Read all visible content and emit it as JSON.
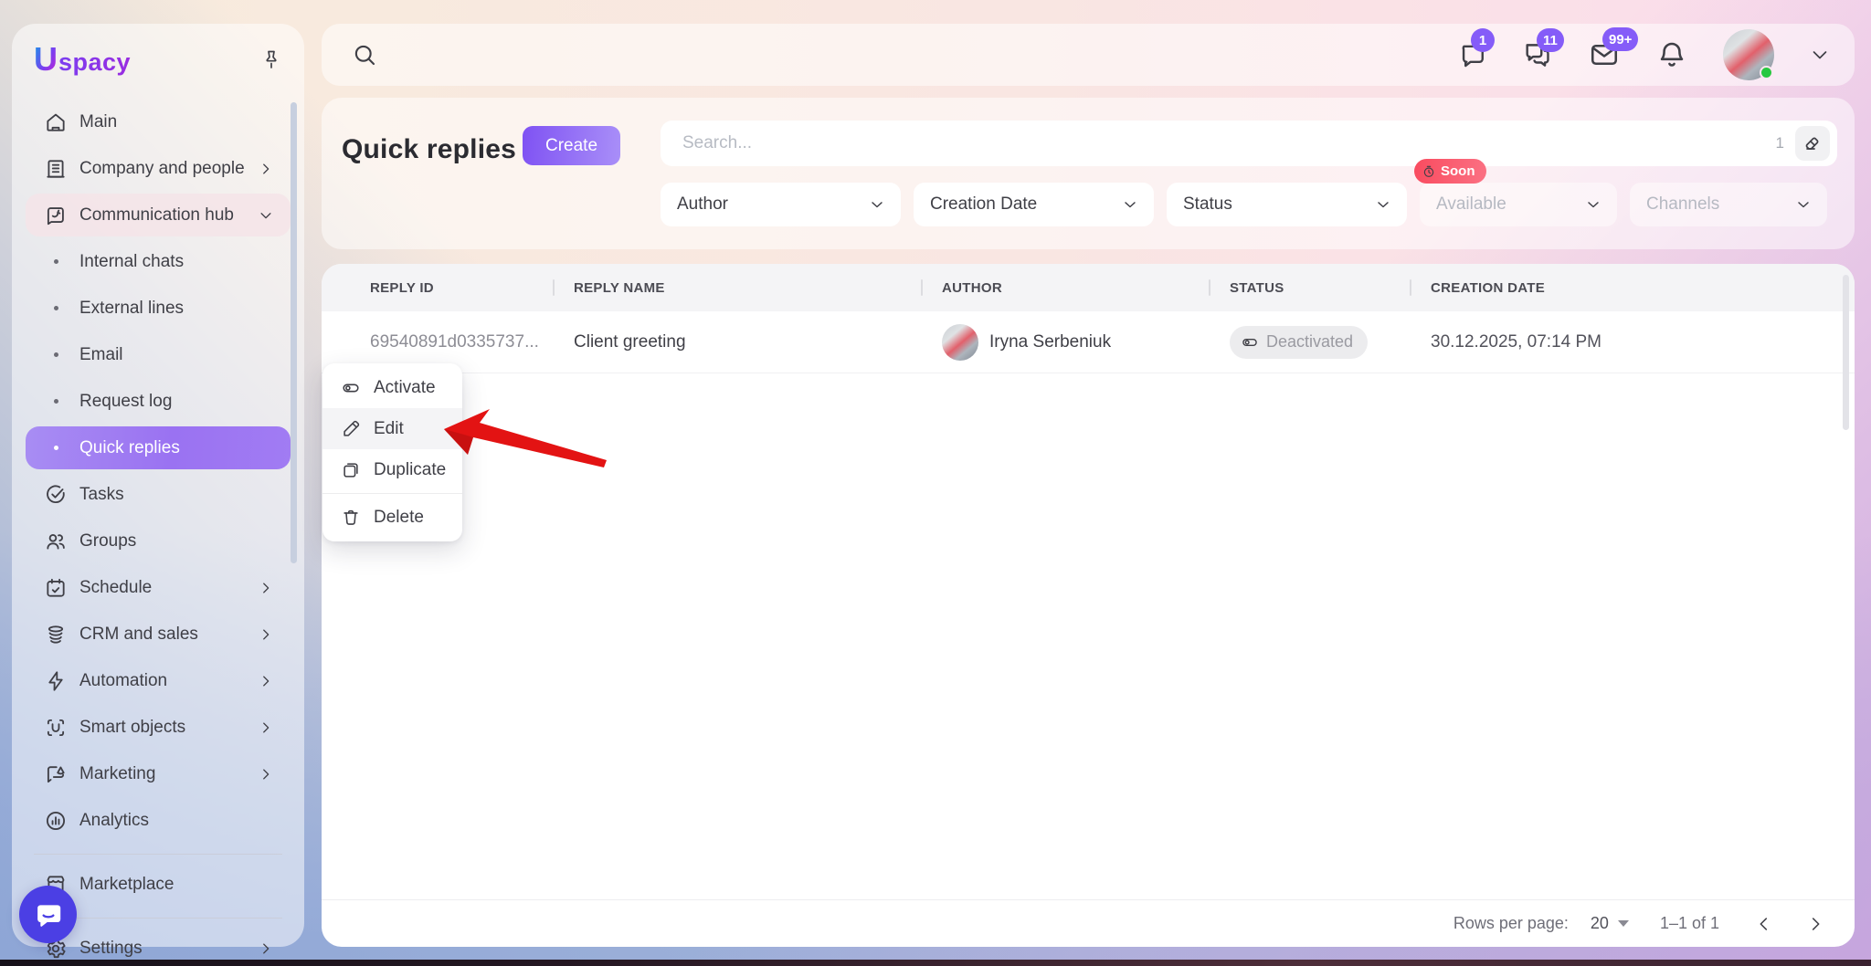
{
  "brand": {
    "logo_u": "U",
    "logo_rest": "spacy"
  },
  "topbar": {
    "badge_chat": "1",
    "badge_group_chat": "11",
    "badge_mail": "99+"
  },
  "sidebar": {
    "items": [
      {
        "label": "Main"
      },
      {
        "label": "Company and people"
      },
      {
        "label": "Communication hub"
      },
      {
        "label": "Internal chats"
      },
      {
        "label": "External lines"
      },
      {
        "label": "Email"
      },
      {
        "label": "Request log"
      },
      {
        "label": "Quick replies"
      },
      {
        "label": "Tasks"
      },
      {
        "label": "Groups"
      },
      {
        "label": "Schedule"
      },
      {
        "label": "CRM and sales"
      },
      {
        "label": "Automation"
      },
      {
        "label": "Smart objects"
      },
      {
        "label": "Marketing"
      },
      {
        "label": "Analytics"
      },
      {
        "label": "Marketplace"
      },
      {
        "label": "Settings"
      }
    ]
  },
  "header": {
    "title": "Quick replies",
    "create_label": "Create",
    "search_placeholder": "Search...",
    "search_result_count": "1",
    "soon_badge": "Soon",
    "filters": [
      {
        "label": "Author"
      },
      {
        "label": "Creation Date"
      },
      {
        "label": "Status"
      },
      {
        "label": "Available"
      },
      {
        "label": "Channels"
      }
    ]
  },
  "table": {
    "columns": [
      "REPLY ID",
      "REPLY NAME",
      "AUTHOR",
      "STATUS",
      "CREATION DATE"
    ],
    "rows": [
      {
        "reply_id": "69540891d0335737...",
        "reply_name": "Client greeting",
        "author": "Iryna Serbeniuk",
        "status": "Deactivated",
        "creation_date": "30.12.2025, 07:14 PM"
      }
    ]
  },
  "context_menu": {
    "items": [
      "Activate",
      "Edit",
      "Duplicate",
      "Delete"
    ]
  },
  "pagination": {
    "rows_per_page_label": "Rows per page:",
    "rows_per_page_value": "20",
    "range_label": "1–1 of 1"
  },
  "colors": {
    "accent_purple": "#8b5cf6",
    "badge_purple": "#855cf8",
    "soon_red": "#f94b5f",
    "arrow_red": "#e31313",
    "online_green": "#27c840"
  }
}
